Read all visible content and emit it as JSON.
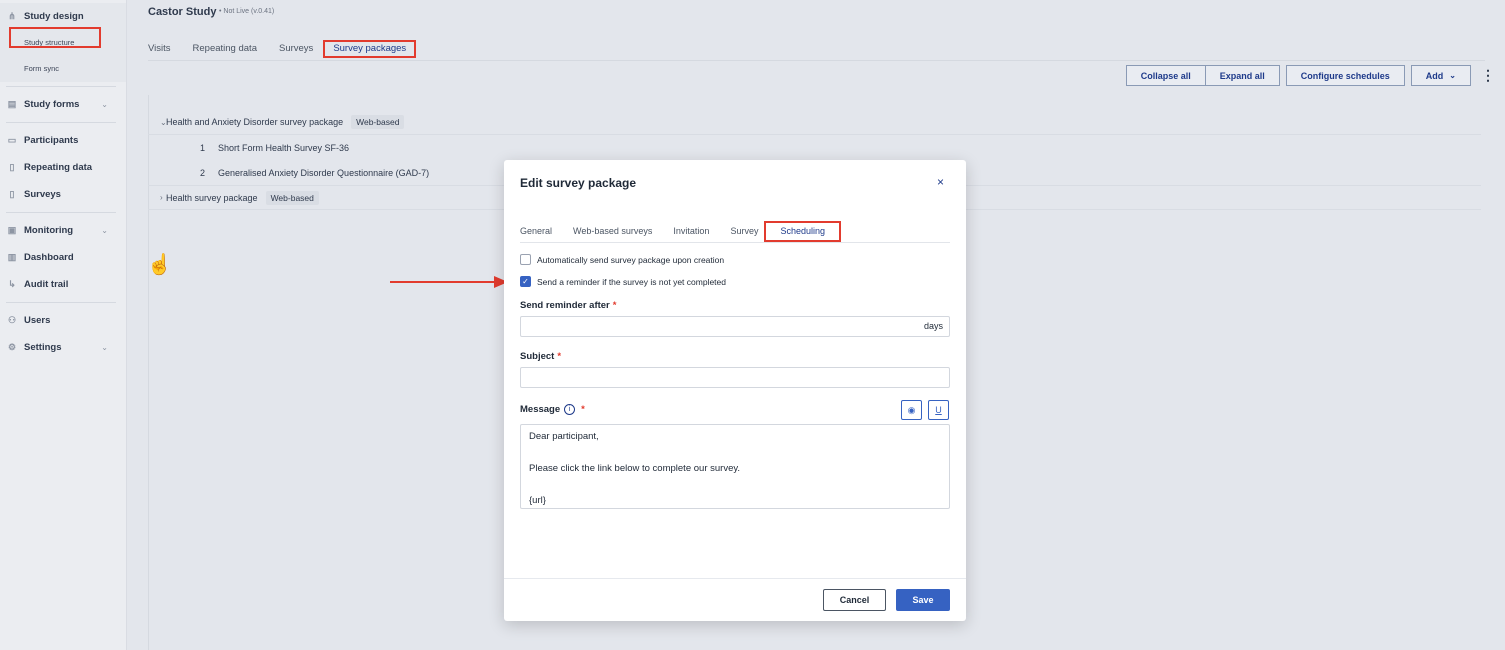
{
  "sidebar": {
    "sections": [
      {
        "label": "Study design",
        "icon": "sitemap-icon"
      },
      {
        "label": "Study forms",
        "icon": "form-icon"
      },
      {
        "label": "Participants",
        "icon": "folder-icon"
      },
      {
        "label": "Repeating data",
        "icon": "file-icon"
      },
      {
        "label": "Surveys",
        "icon": "file-icon"
      },
      {
        "label": "Monitoring",
        "icon": "monitor-icon"
      },
      {
        "label": "Dashboard",
        "icon": "chart-icon"
      },
      {
        "label": "Audit trail",
        "icon": "trail-icon"
      },
      {
        "label": "Users",
        "icon": "users-icon"
      },
      {
        "label": "Settings",
        "icon": "gear-icon"
      }
    ],
    "sub_items": [
      "Study structure",
      "Form sync"
    ]
  },
  "header": {
    "study_name": "Castor Study",
    "status": "• Not Live (v.0.41)"
  },
  "tabs": [
    "Visits",
    "Repeating data",
    "Surveys",
    "Survey packages"
  ],
  "toolbar": {
    "collapse_all": "Collapse all",
    "expand_all": "Expand all",
    "configure_schedules": "Configure schedules",
    "add": "Add"
  },
  "tree": {
    "packages": [
      {
        "name": "Health and Anxiety Disorder survey package",
        "badge": "Web-based",
        "children": [
          {
            "num": "1",
            "name": "Short Form Health Survey SF-36"
          },
          {
            "num": "2",
            "name": "Generalised Anxiety Disorder Questionnaire (GAD-7)"
          }
        ]
      },
      {
        "name": "Health survey package",
        "badge": "Web-based"
      }
    ]
  },
  "modal": {
    "title": "Edit survey package",
    "close": "×",
    "tabs": [
      "General",
      "Web-based surveys",
      "Invitation",
      "Survey",
      "Scheduling"
    ],
    "auto_send_label": "Automatically send survey package upon creation",
    "auto_send_checked": false,
    "reminder_label": "Send a reminder if the survey is not yet completed",
    "reminder_checked": true,
    "send_reminder_after_label": "Send reminder after",
    "days_suffix": "days",
    "subject_label": "Subject",
    "message_label": "Message",
    "message_body": "Dear participant,\n\nPlease click the link below to complete our survey.\n\n{url}",
    "cancel": "Cancel",
    "save": "Save"
  },
  "accent_color": "#3662c2",
  "highlight_color": "#e23b2e"
}
